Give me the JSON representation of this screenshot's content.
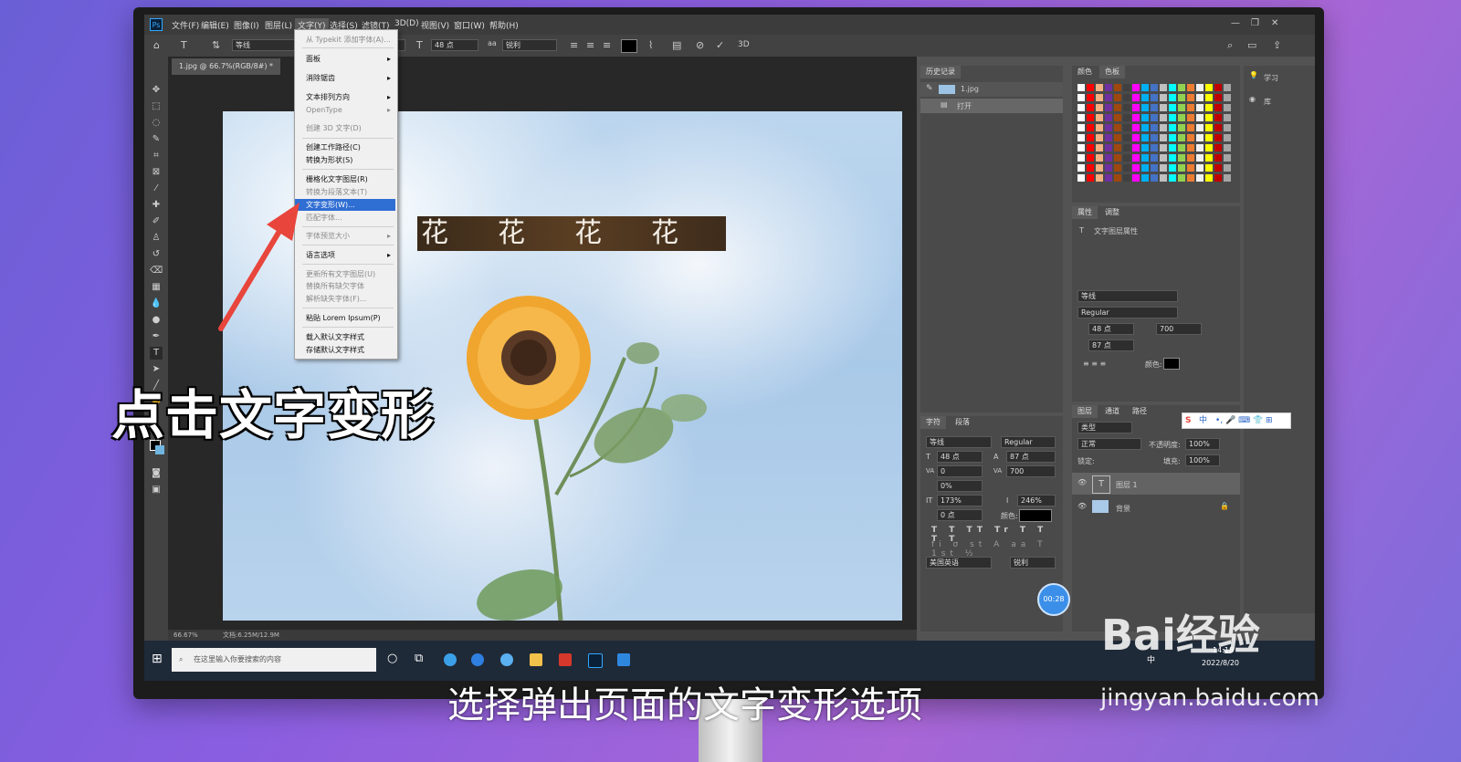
{
  "menubar": {
    "items": [
      "文件(F)",
      "编辑(E)",
      "图像(I)",
      "图层(L)",
      "文字(Y)",
      "选择(S)",
      "滤镜(T)",
      "3D(D)",
      "视图(V)",
      "窗口(W)",
      "帮助(H)"
    ],
    "active": "文字(Y)"
  },
  "optionbar": {
    "font": "等线",
    "size": "48 点",
    "aa": "锐利",
    "label_3d": "3D"
  },
  "document": {
    "tab": "1.jpg @ 66.7%(RGB/8#) *",
    "zoom": "66.67%",
    "doc_size": "文档:6.25M/12.9M",
    "text_layer": "花花花花"
  },
  "type_menu": {
    "items": [
      {
        "label": "从 Typekit 添加字体(A)...",
        "disabled": true
      },
      {
        "label": "面板",
        "submenu": true
      },
      {
        "label": "消除锯齿",
        "submenu": true
      },
      {
        "label": "文本排列方向",
        "submenu": true
      },
      {
        "label": "OpenType",
        "submenu": true,
        "disabled": true
      },
      {
        "label": "创建 3D 文字(D)",
        "disabled": true
      },
      {
        "label": "创建工作路径(C)"
      },
      {
        "label": "转换为形状(S)"
      },
      {
        "label": "栅格化文字图层(R)"
      },
      {
        "label": "转换为段落文本(T)",
        "disabled": true
      },
      {
        "label": "文字变形(W)...",
        "highlighted": true
      },
      {
        "label": "匹配字体...",
        "disabled": true
      },
      {
        "label": "字体预览大小",
        "submenu": true,
        "disabled": true
      },
      {
        "label": "语言选项",
        "submenu": true
      },
      {
        "label": "更新所有文字图层(U)",
        "disabled": true
      },
      {
        "label": "替换所有缺欠字体",
        "disabled": true
      },
      {
        "label": "解析缺失字体(F)...",
        "disabled": true
      },
      {
        "label": "粘贴 Lorem Ipsum(P)"
      },
      {
        "label": "载入默认文字样式"
      },
      {
        "label": "存储默认文字样式"
      }
    ]
  },
  "history_panel": {
    "title": "历史记录",
    "snapshot": "1.jpg",
    "step": "打开"
  },
  "color_panel": {
    "tabs": [
      "颜色",
      "色板"
    ]
  },
  "properties_panel": {
    "tabs": [
      "属性",
      "调整"
    ],
    "section": "文字图层属性",
    "font": "等线",
    "style": "Regular",
    "size": "48 点",
    "tracking": "700",
    "leading": "87 点",
    "color_label": "颜色:"
  },
  "learn_panel": {
    "learn": "学习",
    "lib": "库"
  },
  "character_panel": {
    "tabs": [
      "字符",
      "段落"
    ],
    "font": "等线",
    "style": "Regular",
    "size": "48 点",
    "leading": "87 点",
    "kerning": "0",
    "tracking": "700",
    "scale_v": "0%",
    "scale_h1": "173%",
    "scale_h2": "246%",
    "baseline": "0 点",
    "color_label": "颜色:",
    "language": "美国英语",
    "aa": "锐利"
  },
  "layers_panel": {
    "tabs": [
      "图层",
      "通道",
      "路径"
    ],
    "search": "类型",
    "blend": "正常",
    "opacity_label": "不透明度:",
    "opacity": "100%",
    "lock_label": "锁定:",
    "fill_label": "填充:",
    "fill": "100%",
    "layers": [
      "图层 1",
      "背景"
    ]
  },
  "taskbar": {
    "search_placeholder": "在这里输入你要搜索的内容",
    "ime": "中",
    "time": "14:18",
    "date": "2022/8/20"
  },
  "overlay": {
    "caption": "点击文字变形",
    "subtitle": "选择弹出页面的文字变形选项",
    "timer": "00:28",
    "watermark": "Bai经验",
    "watermark_url": "jingyan.baidu.com"
  }
}
